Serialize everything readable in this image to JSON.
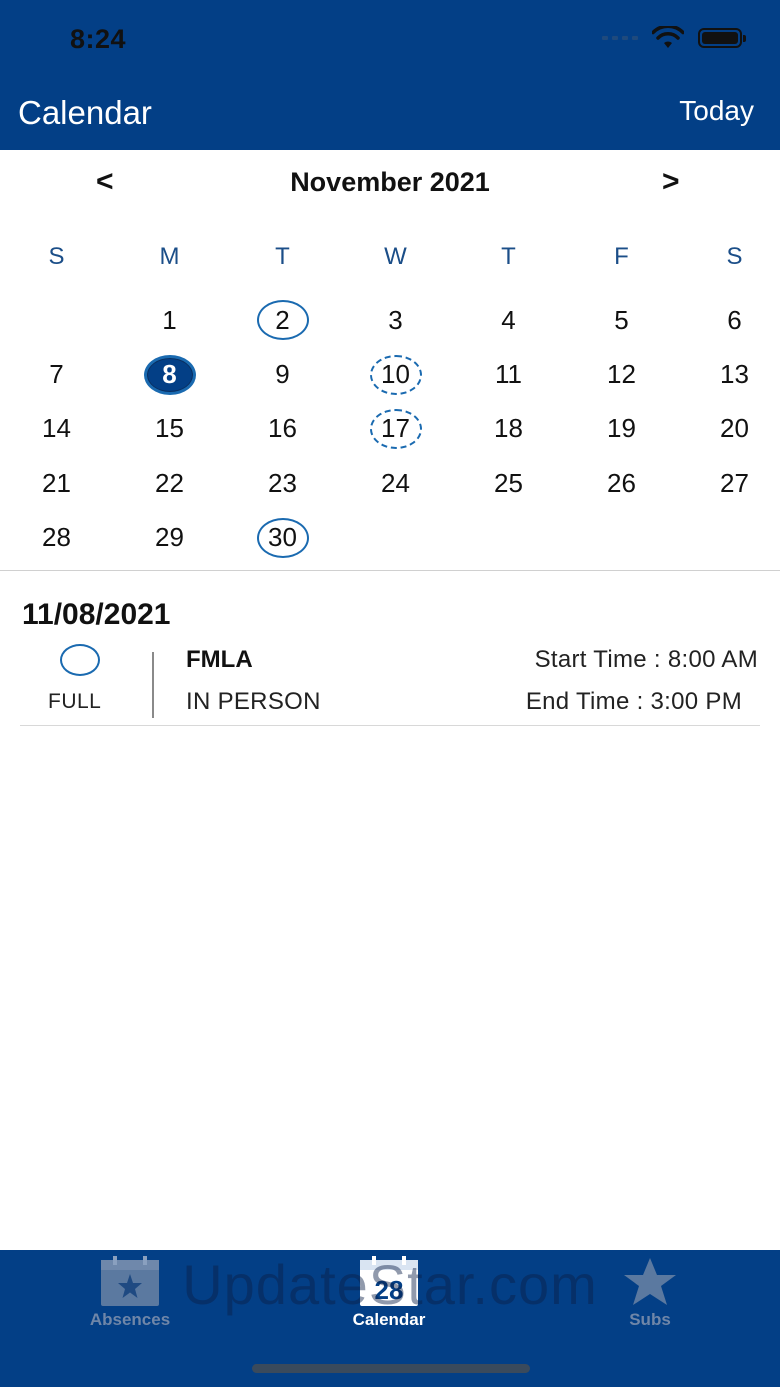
{
  "status_bar": {
    "time": "8:24"
  },
  "header": {
    "title": "Calendar",
    "today_label": "Today"
  },
  "month_nav": {
    "prev": "<",
    "next": ">",
    "label": "November 2021"
  },
  "weekdays": [
    "S",
    "M",
    "T",
    "W",
    "T",
    "F",
    "S"
  ],
  "days": [
    {
      "label": ""
    },
    {
      "label": "1"
    },
    {
      "label": "2",
      "mark": "solid"
    },
    {
      "label": "3"
    },
    {
      "label": "4"
    },
    {
      "label": "5"
    },
    {
      "label": "6"
    },
    {
      "label": "7"
    },
    {
      "label": "8",
      "mark": "selected"
    },
    {
      "label": "9"
    },
    {
      "label": "10",
      "mark": "dashed"
    },
    {
      "label": "11"
    },
    {
      "label": "12"
    },
    {
      "label": "13"
    },
    {
      "label": "14"
    },
    {
      "label": "15"
    },
    {
      "label": "16"
    },
    {
      "label": "17",
      "mark": "dashed"
    },
    {
      "label": "18"
    },
    {
      "label": "19"
    },
    {
      "label": "20"
    },
    {
      "label": "21"
    },
    {
      "label": "22"
    },
    {
      "label": "23"
    },
    {
      "label": "24"
    },
    {
      "label": "25"
    },
    {
      "label": "26"
    },
    {
      "label": "27"
    },
    {
      "label": "28"
    },
    {
      "label": "29"
    },
    {
      "label": "30",
      "mark": "solid"
    }
  ],
  "event": {
    "date": "11/08/2021",
    "duration": "FULL",
    "type": "FMLA",
    "mode": "IN PERSON",
    "start": "Start Time : 8:00 AM",
    "end": "End Time : 3:00 PM"
  },
  "tabbar": {
    "tabs": [
      {
        "label": "Absences",
        "icon": "calendar-star-icon",
        "active": false
      },
      {
        "label": "Calendar",
        "icon": "calendar-28-icon",
        "badge": "28",
        "active": true
      },
      {
        "label": "Subs",
        "icon": "star-icon",
        "active": false
      }
    ]
  },
  "watermark": "UpdateStar.com",
  "colors": {
    "primary": "#033f86",
    "accent": "#1a6ab0"
  }
}
